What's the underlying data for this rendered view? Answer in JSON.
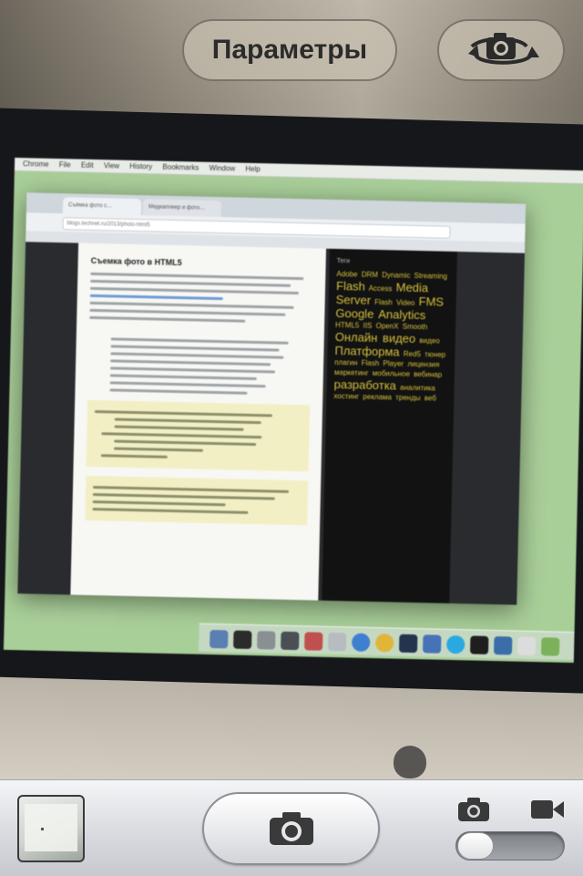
{
  "top_controls": {
    "options_label": "Параметры",
    "flip_icon": "camera-flip-icon"
  },
  "bottom_bar": {
    "thumbnail_icon": "last-photo-thumbnail",
    "shutter_icon": "camera-icon",
    "mode_photo_icon": "camera-icon",
    "mode_video_icon": "video-camera-icon",
    "mode_selected": "photo"
  },
  "scene": {
    "menubar": [
      "Chrome",
      "File",
      "Edit",
      "View",
      "History",
      "Bookmarks",
      "Window",
      "Help"
    ],
    "browser": {
      "tabs": [
        "Съёмка фото с…",
        "Медиаплеер и фото…"
      ],
      "url": "blogs.technet.ru/2013/photo-html5",
      "article_title": "Съемка фото в HTML5"
    },
    "tag_cloud": {
      "title": "Теги",
      "small_tags": [
        "Adobe",
        "DRM",
        "Dynamic Streaming",
        "Flash",
        "Access",
        "HTML5",
        "IIS",
        "OpenX",
        "Smooth",
        "видео",
        "Flash Video",
        "Red5",
        "тюнер",
        "плагин",
        "Flash Player",
        "лицензия",
        "маркетинг",
        "мобильное",
        "вебинар",
        "аналитика",
        "хостинг",
        "реклама",
        "тренды",
        "веб"
      ],
      "big_tags": [
        "Media Server",
        "FMS",
        "Google Analytics",
        "Онлайн видео",
        "Платформа",
        "разработка"
      ]
    },
    "colors": {
      "desktop": "#a9cf99",
      "tag_text": "#d6c23c",
      "bezel": "#16171b"
    }
  }
}
